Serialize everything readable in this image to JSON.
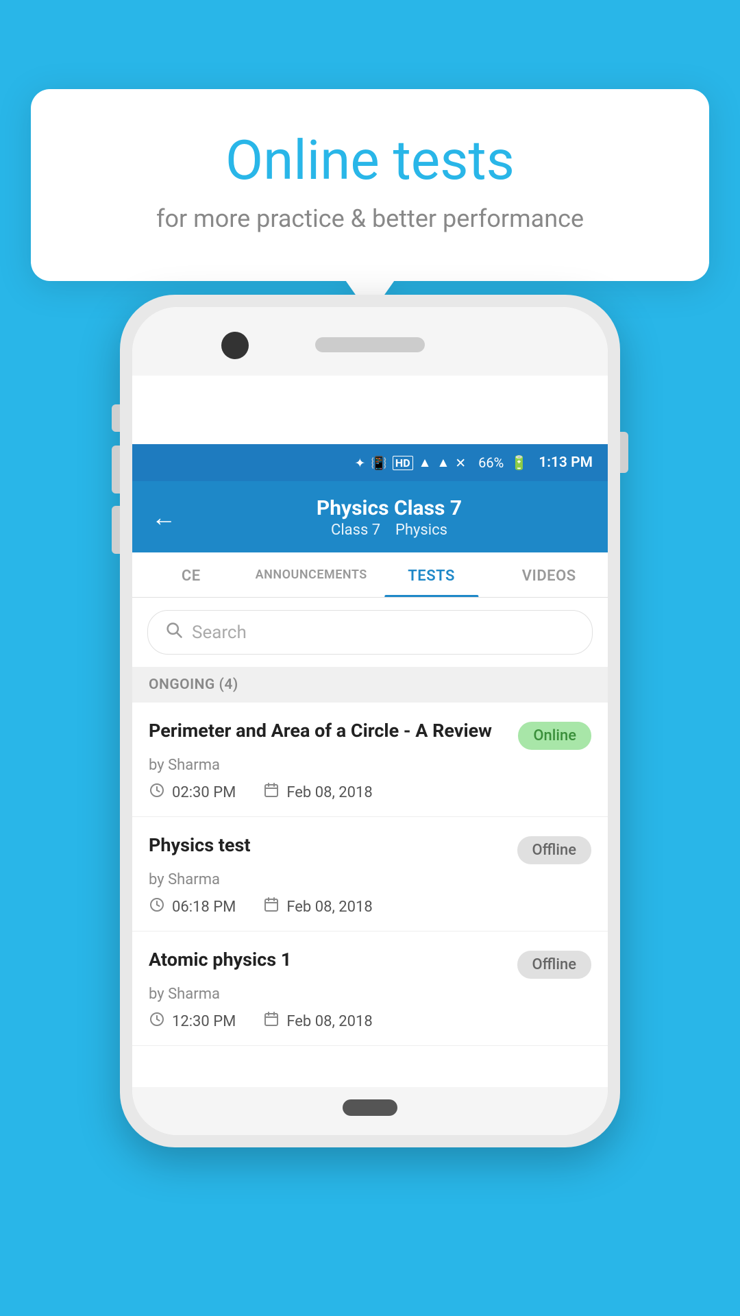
{
  "background_color": "#29b6e8",
  "tooltip": {
    "title": "Online tests",
    "subtitle": "for more practice & better performance"
  },
  "status_bar": {
    "battery_percent": "66%",
    "time": "1:13 PM",
    "icons": [
      "bluetooth",
      "vibrate",
      "hd",
      "wifi",
      "signal",
      "x-signal"
    ]
  },
  "app_bar": {
    "back_label": "←",
    "title": "Physics Class 7",
    "subtitle_class": "Class 7",
    "subtitle_subject": "Physics"
  },
  "tabs": [
    {
      "id": "ce",
      "label": "CE",
      "active": false
    },
    {
      "id": "announcements",
      "label": "ANNOUNCEMENTS",
      "active": false
    },
    {
      "id": "tests",
      "label": "TESTS",
      "active": true
    },
    {
      "id": "videos",
      "label": "VIDEOS",
      "active": false
    }
  ],
  "search": {
    "placeholder": "Search"
  },
  "sections": [
    {
      "id": "ongoing",
      "label": "ONGOING (4)",
      "items": [
        {
          "id": "test1",
          "title": "Perimeter and Area of a Circle - A Review",
          "by": "by Sharma",
          "time": "02:30 PM",
          "date": "Feb 08, 2018",
          "status": "Online",
          "status_type": "online"
        },
        {
          "id": "test2",
          "title": "Physics test",
          "by": "by Sharma",
          "time": "06:18 PM",
          "date": "Feb 08, 2018",
          "status": "Offline",
          "status_type": "offline"
        },
        {
          "id": "test3",
          "title": "Atomic physics 1",
          "by": "by Sharma",
          "time": "12:30 PM",
          "date": "Feb 08, 2018",
          "status": "Offline",
          "status_type": "offline"
        }
      ]
    }
  ]
}
